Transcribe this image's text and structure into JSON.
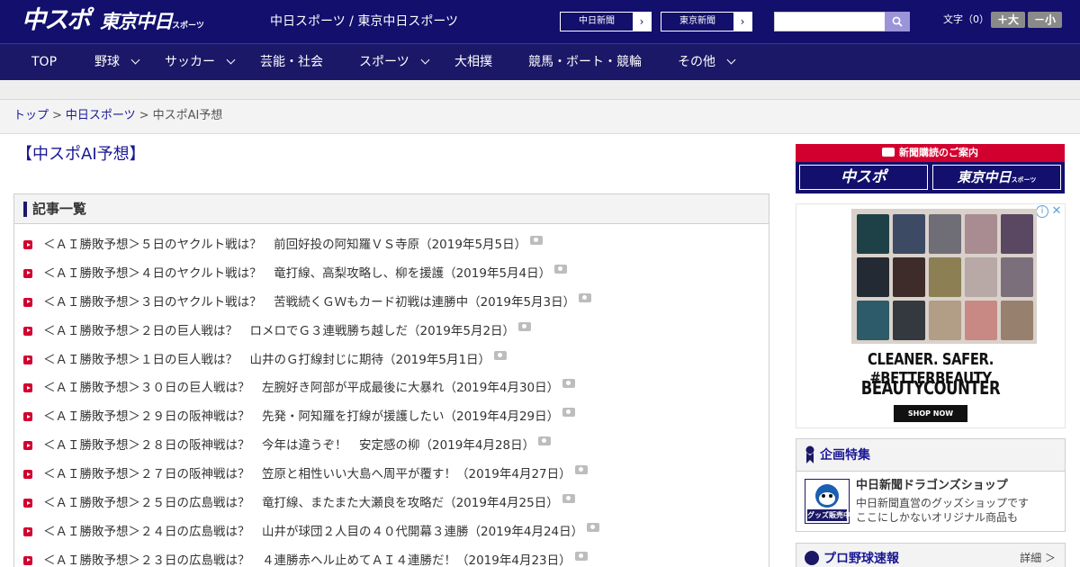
{
  "header": {
    "logo_chuspo": "中スポ",
    "logo_tokyo": "東京中日",
    "logo_tokyo_suffix": "スポーツ",
    "title": "中日スポーツ / 東京中日スポーツ",
    "newspaper_buttons": [
      "中日新聞",
      "東京新聞"
    ],
    "search_placeholder": "",
    "font_size_label": "文字（0）",
    "font_larger": "＋大",
    "font_smaller": "－小"
  },
  "nav": [
    {
      "label": "TOP",
      "has_dropdown": false
    },
    {
      "label": "野球",
      "has_dropdown": true
    },
    {
      "label": "サッカー",
      "has_dropdown": true
    },
    {
      "label": "芸能・社会",
      "has_dropdown": false
    },
    {
      "label": "スポーツ",
      "has_dropdown": true
    },
    {
      "label": "大相撲",
      "has_dropdown": false
    },
    {
      "label": "競馬・ボート・競輪",
      "has_dropdown": false
    },
    {
      "label": "その他",
      "has_dropdown": true
    }
  ],
  "breadcrumb": {
    "items": [
      "トップ",
      "中日スポーツ"
    ],
    "current": "中スポAI予想",
    "separator": ">"
  },
  "page_title": "【中スポAI予想】",
  "article_list": {
    "heading": "記事一覧",
    "items": [
      "＜ＡＩ勝敗予想＞５日のヤクルト戦は？　前回好投の阿知羅ＶＳ寺原（2019年5月5日）",
      "＜ＡＩ勝敗予想＞４日のヤクルト戦は？　竜打線、高梨攻略し、柳を援護（2019年5月4日）",
      "＜ＡＩ勝敗予想＞３日のヤクルト戦は？　苦戦続くＧＷもカード初戦は連勝中（2019年5月3日）",
      "＜ＡＩ勝敗予想＞２日の巨人戦は？　ロメロでＧ３連戦勝ち越しだ（2019年5月2日）",
      "＜ＡＩ勝敗予想＞１日の巨人戦は？　山井のＧ打線封じに期待（2019年5月1日）",
      "＜ＡＩ勝敗予想＞３０日の巨人戦は？　左腕好き阿部が平成最後に大暴れ（2019年4月30日）",
      "＜ＡＩ勝敗予想＞２９日の阪神戦は？　先発・阿知羅を打線が援護したい（2019年4月29日）",
      "＜ＡＩ勝敗予想＞２８日の阪神戦は？　今年は違うぞ！　安定感の柳（2019年4月28日）",
      "＜ＡＩ勝敗予想＞２７日の阪神戦は？　笠原と相性いい大島へ周平が覆す！（2019年4月27日）",
      "＜ＡＩ勝敗予想＞２５日の広島戦は？　竜打線、またまた大瀬良を攻略だ（2019年4月25日）",
      "＜ＡＩ勝敗予想＞２４日の広島戦は？　山井が球団２人目の４０代開幕３連勝（2019年4月24日）",
      "＜ＡＩ勝敗予想＞２３日の広島戦は？　４連勝赤ヘル止めてＡＩ４連勝だ！（2019年4月23日）"
    ]
  },
  "sidebar": {
    "subscription_banner": {
      "heading": "新聞購読のご案内",
      "logos": [
        "中スポ",
        "東京中日"
      ],
      "logo_suffix": "スポーツ"
    },
    "ad": {
      "headline": "CLEANER. SAFER. #BETTERBEAUTY",
      "brand": "BEAUTYCOUNTER",
      "cta": "SHOP NOW",
      "palette_colors": [
        "#1e4147",
        "#3c4a64",
        "#6f6e77",
        "#a88c92",
        "#5a4761",
        "#242a33",
        "#3d2c2a",
        "#8c7f54",
        "#b8a8a6",
        "#7a6f7a",
        "#2d5b6a",
        "#34383f",
        "#b29d86",
        "#c88985",
        "#98806e"
      ]
    },
    "kikaku": {
      "heading": "企画特集",
      "shop_title": "中日新聞ドラゴンズショップ",
      "shop_desc_1": "中日新聞直営のグッズショップです",
      "shop_desc_2": "ここにしかないオリジナル商品も",
      "shop_icon_label": "グッズ販売中"
    },
    "yakyu": {
      "heading": "プロ野球速報",
      "more": "詳細 ＞"
    }
  },
  "colors": {
    "header_bg": "#120f6d",
    "nav_bg": "#1b1867",
    "link": "#1a1894",
    "accent_red": "#d2002e"
  }
}
